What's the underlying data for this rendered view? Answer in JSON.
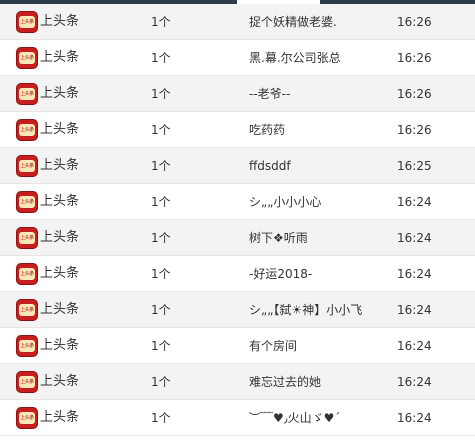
{
  "colors": {
    "row_alt_bg": "#f3f3f3",
    "divider": "#e6e6e6",
    "logo_red": "#c61f1f",
    "top_bar": "#2e3b4a"
  },
  "rows": [
    {
      "icon": "toutiao-logo-icon",
      "logo_text": "上头条",
      "name": "上头条",
      "count": "1个",
      "user": "捉个妖精做老婆.",
      "time": "16:26"
    },
    {
      "icon": "toutiao-logo-icon",
      "logo_text": "上头条",
      "name": "上头条",
      "count": "1个",
      "user": "黑.幕.尔公司张总",
      "time": "16:26"
    },
    {
      "icon": "toutiao-logo-icon",
      "logo_text": "上头条",
      "name": "上头条",
      "count": "1个",
      "user": "--老爷--",
      "time": "16:26"
    },
    {
      "icon": "toutiao-logo-icon",
      "logo_text": "上头条",
      "name": "上头条",
      "count": "1个",
      "user": "吃药药",
      "time": "16:26"
    },
    {
      "icon": "toutiao-logo-icon",
      "logo_text": "上头条",
      "name": "上头条",
      "count": "1个",
      "user": "ffdsddf",
      "time": "16:25"
    },
    {
      "icon": "toutiao-logo-icon",
      "logo_text": "上头条",
      "name": "上头条",
      "count": "1个",
      "user": "シ„„小小小心",
      "time": "16:24"
    },
    {
      "icon": "toutiao-logo-icon",
      "logo_text": "上头条",
      "name": "上头条",
      "count": "1个",
      "user": "树下❖听雨",
      "time": "16:24"
    },
    {
      "icon": "toutiao-logo-icon",
      "logo_text": "上头条",
      "name": "上头条",
      "count": "1个",
      "user": "-好运2018-",
      "time": "16:24"
    },
    {
      "icon": "toutiao-logo-icon",
      "logo_text": "上头条",
      "name": "上头条",
      "count": "1个",
      "user": "シ„„【弑☀神】小小飞",
      "time": "16:24"
    },
    {
      "icon": "toutiao-logo-icon",
      "logo_text": "上头条",
      "name": "上头条",
      "count": "1个",
      "user": "有个房间",
      "time": "16:24"
    },
    {
      "icon": "toutiao-logo-icon",
      "logo_text": "上头条",
      "name": "上头条",
      "count": "1个",
      "user": "难忘过去的她",
      "time": "16:24"
    },
    {
      "icon": "toutiao-logo-icon",
      "logo_text": "上头条",
      "name": "上头条",
      "count": "1个",
      "user": "︶﹋♥٫火山ゞ♥ˊ",
      "time": "16:24"
    }
  ]
}
